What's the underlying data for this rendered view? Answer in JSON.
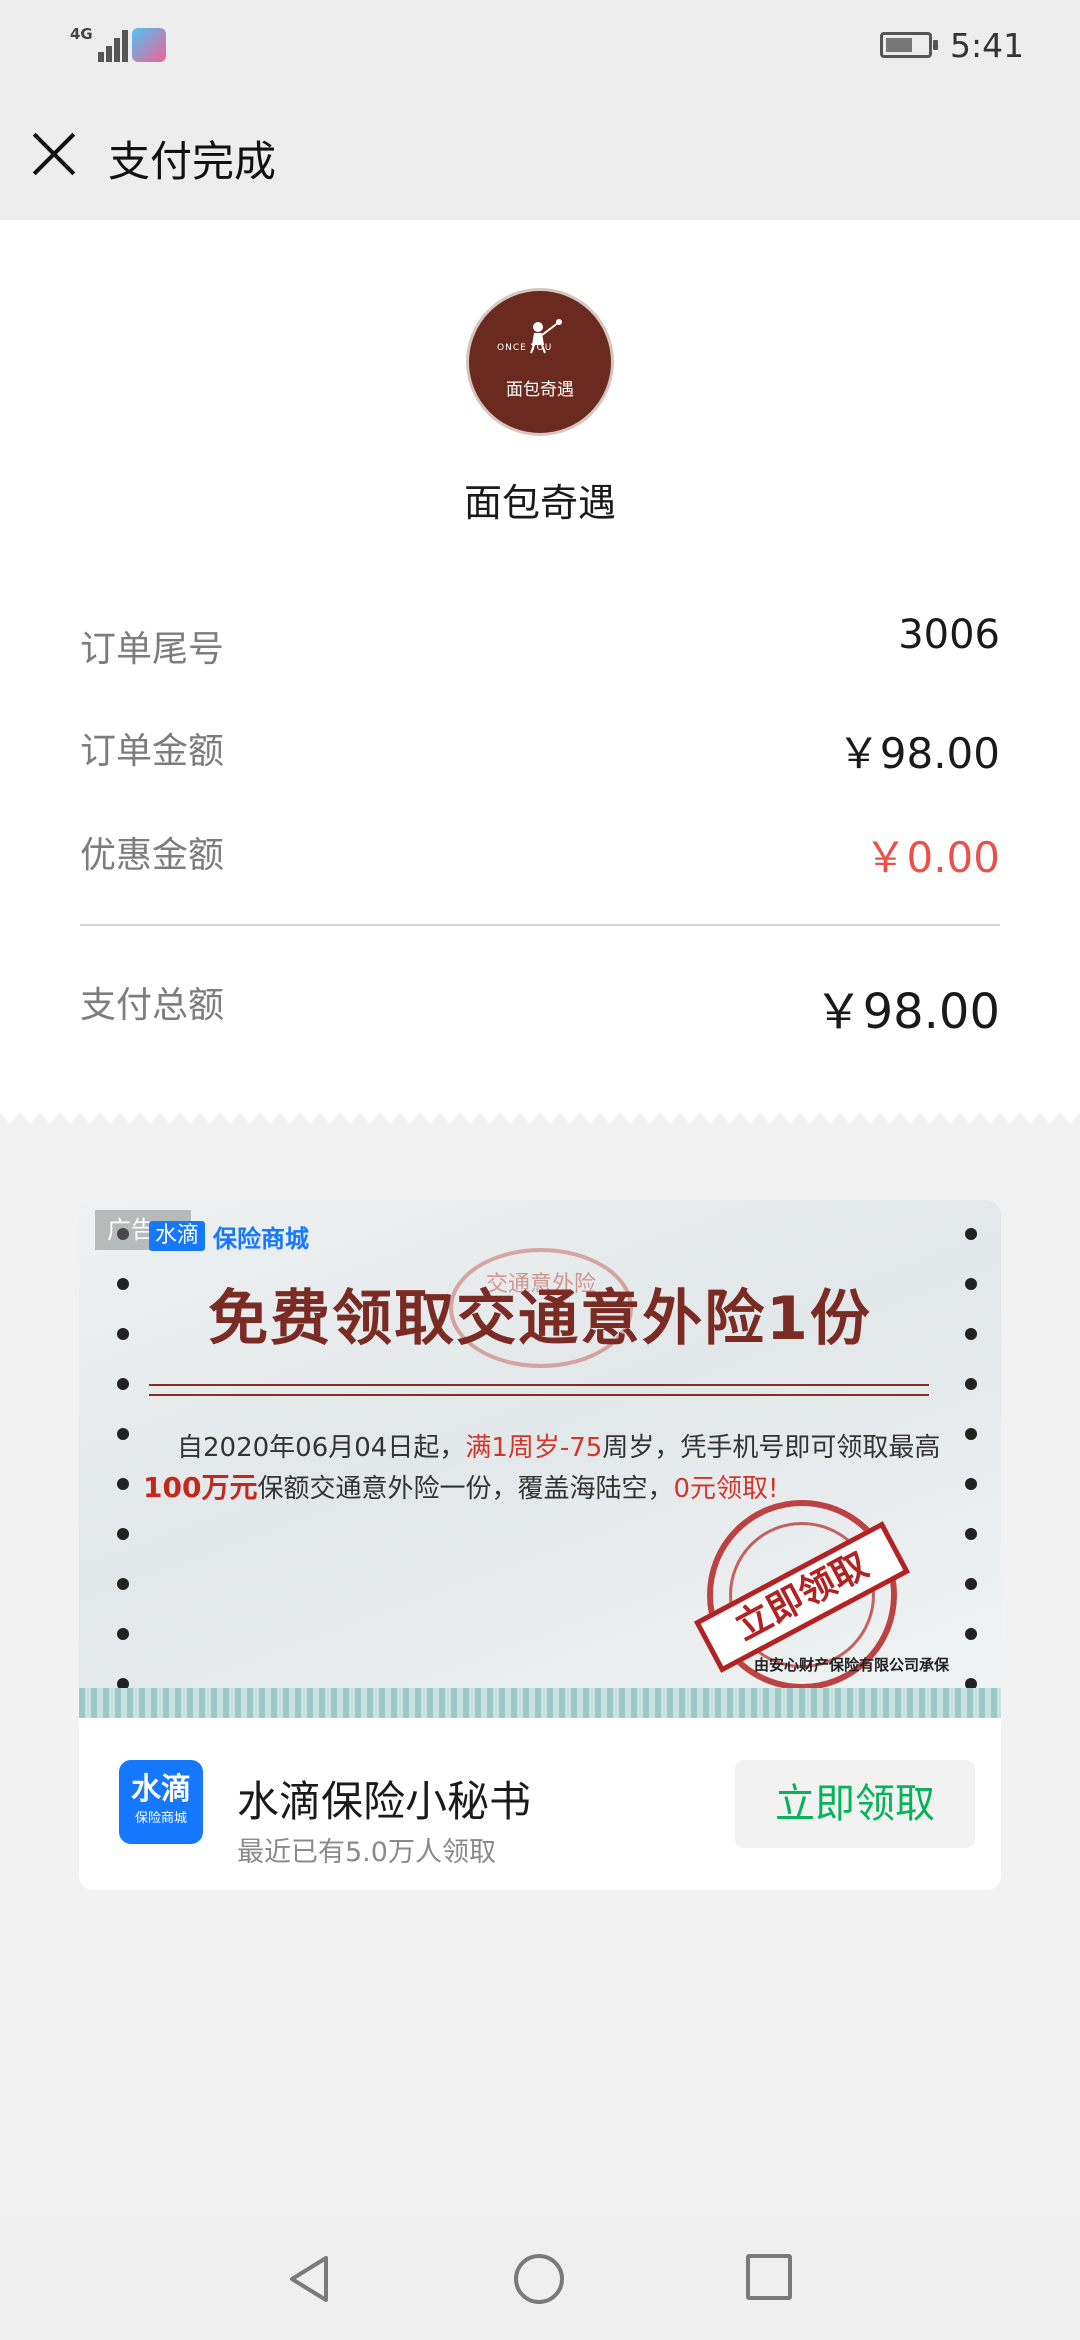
{
  "status_bar": {
    "network": "4G",
    "time": "5:41"
  },
  "header": {
    "title": "支付完成"
  },
  "merchant": {
    "logo_text": "面包奇遇",
    "logo_small": "ONCE YOU",
    "name": "面包奇遇"
  },
  "order": {
    "rows": [
      {
        "label": "订单尾号",
        "value": "3006"
      },
      {
        "label": "订单金额",
        "value": "￥98.00"
      },
      {
        "label": "优惠金额",
        "value": "￥0.00"
      }
    ],
    "total": {
      "label": "支付总额",
      "value": "￥98.00"
    }
  },
  "ad": {
    "badge": "广告",
    "brand_logo": "水滴",
    "brand_mall": "保险商城",
    "title": "免费领取交通意外险1份",
    "stamp_text": "交通意外险",
    "line1_a": "自2020年06月04日起，",
    "line1_b": "满1周岁-75",
    "line1_c": "周岁，凭手机号即可领取最高",
    "line2_a": "100万元",
    "line2_b": "保额交通意外险一份，覆盖海陆空，",
    "line2_c": "0元领取!",
    "stamp_button": "立即领取",
    "insurer": "由安心财产保险有限公司承保",
    "app_logo_main": "水滴",
    "app_logo_sub": "保险商城",
    "app_name": "水滴保险小秘书",
    "app_sub": "最近已有5.0万人领取",
    "cta": "立即领取"
  },
  "colors": {
    "discount_red": "#e9524a",
    "cta_green": "#07b359",
    "brand_blue": "#1677ff",
    "logo_brown": "#6b2a1f"
  },
  "icons": [
    "close-icon",
    "back-nav-icon",
    "home-nav-icon",
    "recents-nav-icon"
  ]
}
